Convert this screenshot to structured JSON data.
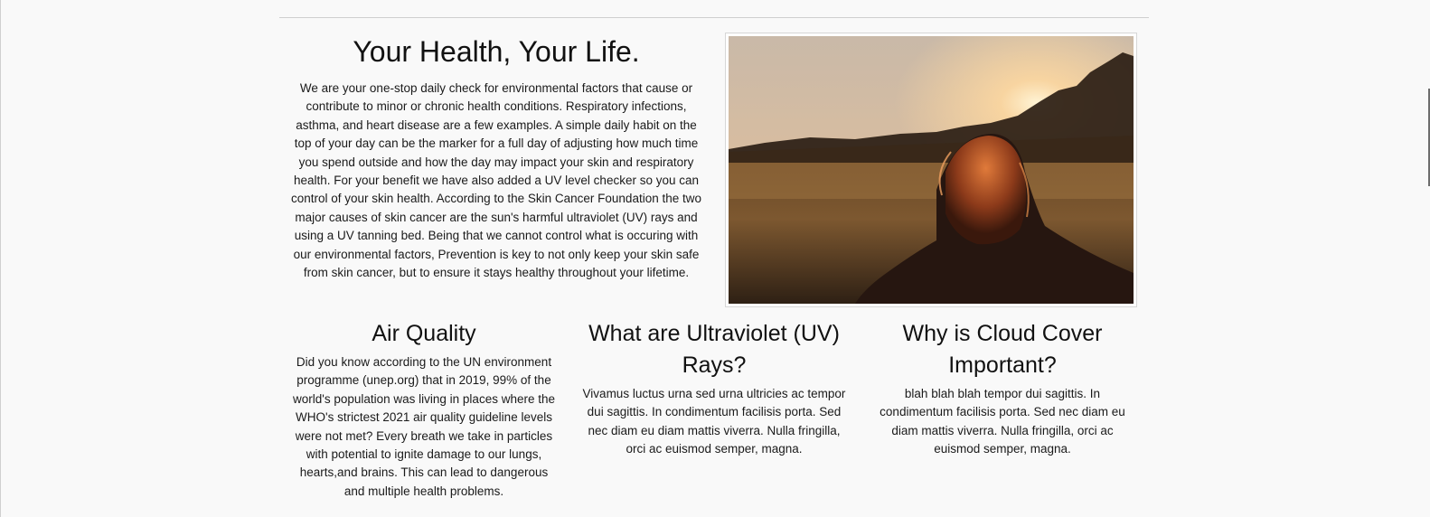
{
  "hero": {
    "title": "Your Health, Your Life.",
    "body": "We are your one-stop daily check for environmental factors that cause or contribute to minor or chronic health conditions. Respiratory infections, asthma, and heart disease are a few examples. A simple daily habit on the top of your day can be the marker for a full day of adjusting how much time you spend outside and how the day may impact your skin and respiratory health. For your benefit we have also added a UV level checker so you can control of your skin health. According to the Skin Cancer Foundation the two major causes of skin cancer are the sun's harmful ultraviolet (UV) rays and using a UV tanning bed. Being that we cannot control what is occuring with our environmental factors, Prevention is key to not only keep your skin safe from skin cancer, but to ensure it stays healthy throughout your lifetime.",
    "image_icon": "photo-woman-field-sunset"
  },
  "sections": [
    {
      "title": "Air Quality",
      "body": "Did you know according to the UN environment programme (unep.org) that in 2019, 99% of the world's population was living in places where the WHO's strictest 2021 air quality guideline levels were not met? Every breath we take in particles with potential to ignite damage to our lungs, hearts,and brains. This can lead to dangerous and multiple health problems."
    },
    {
      "title": "What are Ultraviolet (UV) Rays?",
      "body": "Vivamus luctus urna sed urna ultricies ac tempor dui sagittis. In condimentum facilisis porta. Sed nec diam eu diam mattis viverra. Nulla fringilla, orci ac euismod semper, magna."
    },
    {
      "title": "Why is Cloud Cover Important?",
      "body": "blah blah blah tempor dui sagittis. In condimentum facilisis porta. Sed nec diam eu diam mattis viverra. Nulla fringilla, orci ac euismod semper, magna."
    }
  ],
  "colors": {
    "background": "#f9f9f9",
    "text": "#1a1a1a",
    "rule": "#cfcfcf"
  }
}
